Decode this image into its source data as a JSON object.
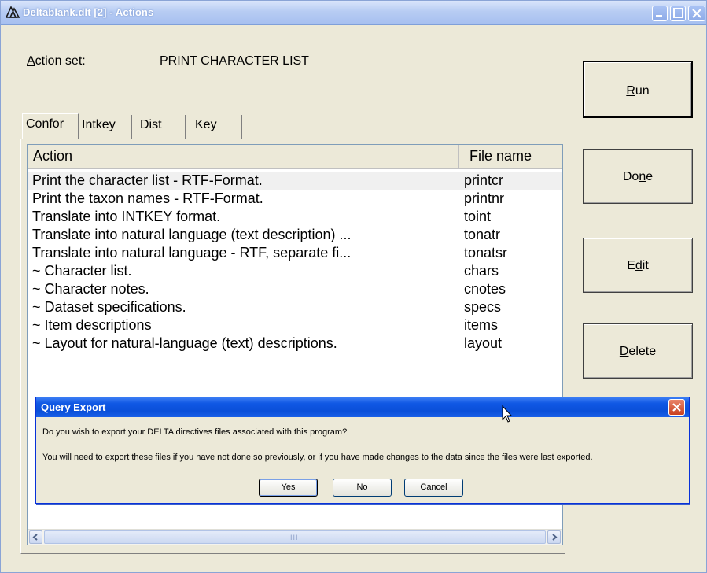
{
  "window": {
    "title": "Deltablank.dlt [2] - Actions"
  },
  "action_set": {
    "label": "Action set:",
    "value": "PRINT CHARACTER LIST"
  },
  "tabs": [
    {
      "label": "Confor",
      "selected": true
    },
    {
      "label": "Intkey",
      "selected": false
    },
    {
      "label": "Dist",
      "selected": false
    },
    {
      "label": "Key",
      "selected": false
    }
  ],
  "list": {
    "columns": [
      "Action",
      "File name"
    ],
    "rows": [
      {
        "action": "Print the character list - RTF-Format.",
        "file": "printcr",
        "selected": true
      },
      {
        "action": "Print the taxon names - RTF-Format.",
        "file": "printnr"
      },
      {
        "action": "Translate into INTKEY format.",
        "file": "toint"
      },
      {
        "action": "Translate into natural language (text description) ...",
        "file": "tonatr"
      },
      {
        "action": "Translate into natural language - RTF, separate fi...",
        "file": "tonatsr"
      },
      {
        "action": "~ Character list.",
        "file": "chars"
      },
      {
        "action": "~ Character notes.",
        "file": "cnotes"
      },
      {
        "action": "~ Dataset specifications.",
        "file": "specs"
      },
      {
        "action": "~ Item descriptions",
        "file": "items"
      },
      {
        "action": "~ Layout for natural-language (text) descriptions.",
        "file": "layout"
      }
    ],
    "scroll_grip": "III"
  },
  "side_buttons": {
    "run": {
      "pre": "",
      "accel": "R",
      "post": "un"
    },
    "done": {
      "pre": "Do",
      "accel": "n",
      "post": "e"
    },
    "edit": {
      "pre": "E",
      "accel": "d",
      "post": "it"
    },
    "delete": {
      "pre": "",
      "accel": "D",
      "post": "elete"
    }
  },
  "dialog": {
    "title": "Query Export",
    "message1": "Do you wish to export your DELTA directives files associated with this program?",
    "message2": "You will need to export these files if you have not done so previously, or if you have made changes to the data since the files were last exported.",
    "yes": "Yes",
    "no": "No",
    "cancel": "Cancel"
  },
  "colors": {
    "dialog_titlebar": "#0a4fd9",
    "window_bg": "#ece9d8",
    "close_button": "#c9401f"
  }
}
